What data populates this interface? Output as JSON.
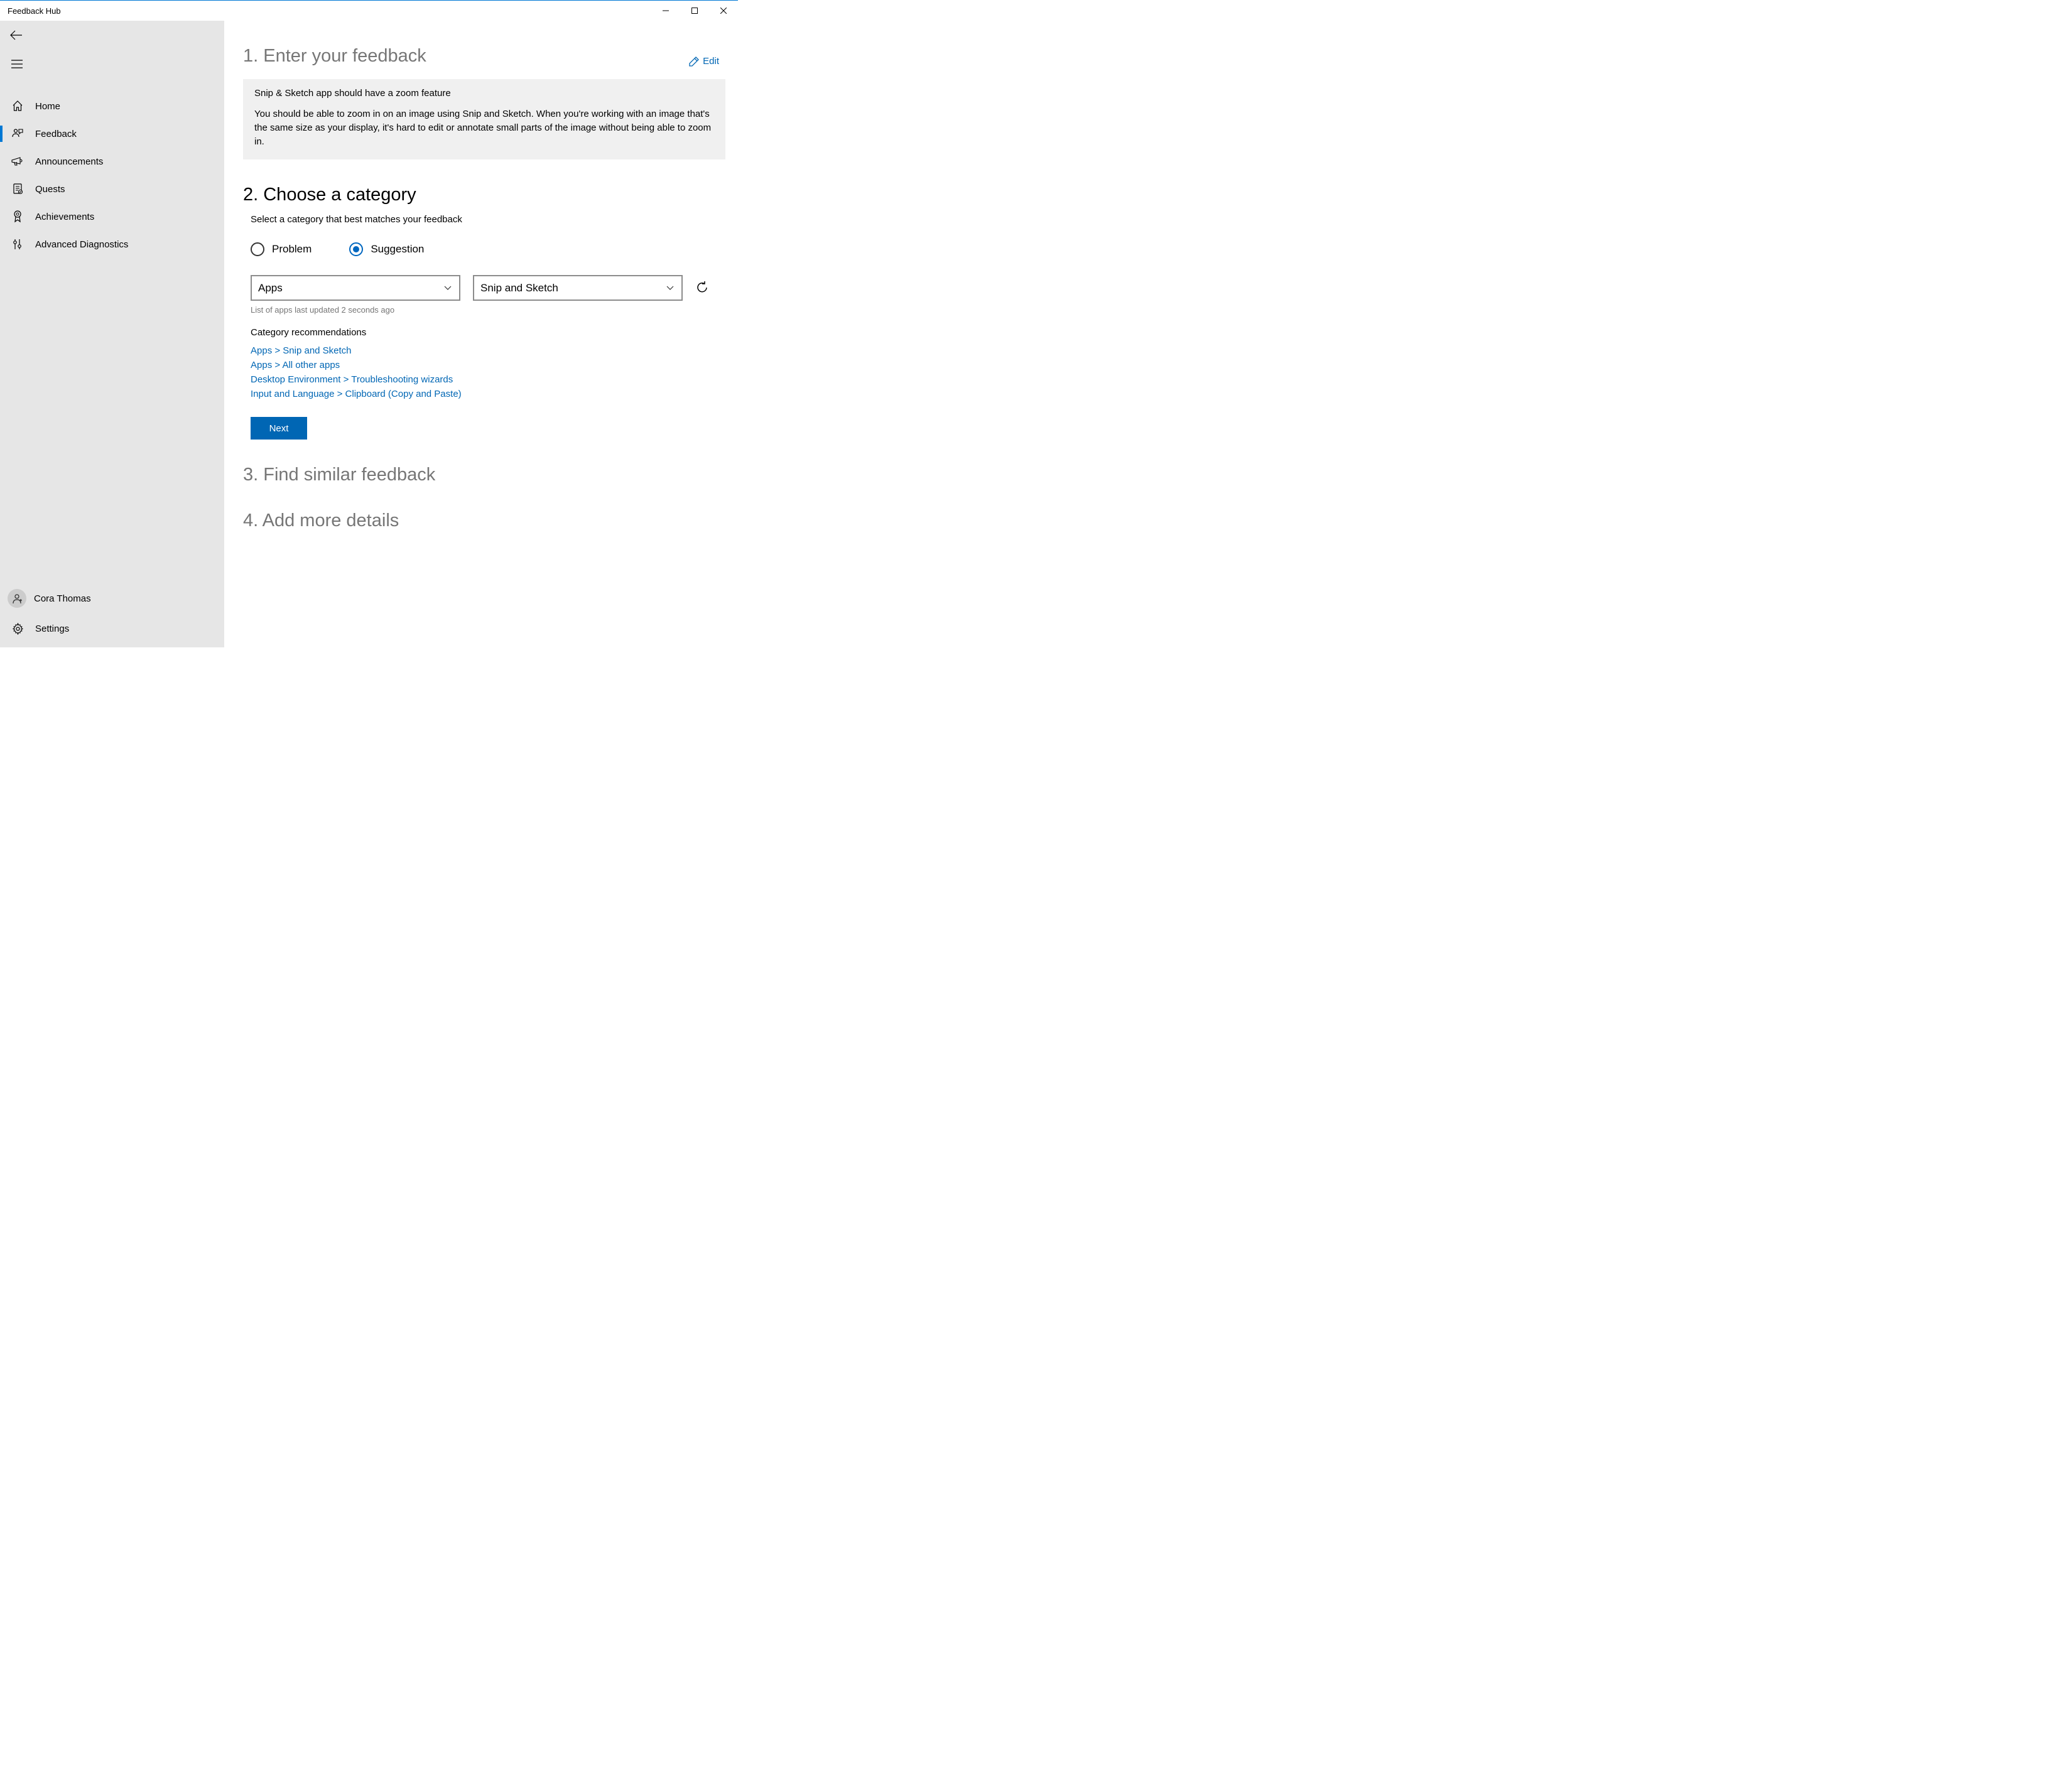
{
  "window": {
    "title": "Feedback Hub"
  },
  "sidebar": {
    "nav": [
      {
        "label": "Home"
      },
      {
        "label": "Feedback"
      },
      {
        "label": "Announcements"
      },
      {
        "label": "Quests"
      },
      {
        "label": "Achievements"
      },
      {
        "label": "Advanced Diagnostics"
      }
    ],
    "user": {
      "name": "Cora Thomas"
    },
    "settings_label": "Settings"
  },
  "step1": {
    "header": "1. Enter your feedback",
    "edit_label": "Edit",
    "title": "Snip & Sketch app should have a zoom feature",
    "description": "You should be able to zoom in on an image using Snip and Sketch. When you're working with an image that's the same size as your display, it's hard to edit or annotate small parts of the image without being able to zoom in."
  },
  "step2": {
    "header": "2. Choose a category",
    "subtitle": "Select a category that best matches your feedback",
    "radio_problem": "Problem",
    "radio_suggestion": "Suggestion",
    "category_value": "Apps",
    "subcategory_value": "Snip and Sketch",
    "list_updated": "List of apps last updated 2 seconds ago",
    "recs_title": "Category recommendations",
    "recs": [
      "Apps > Snip and Sketch",
      "Apps > All other apps",
      "Desktop Environment > Troubleshooting wizards",
      "Input and Language > Clipboard (Copy and Paste)"
    ],
    "next_label": "Next"
  },
  "step3": {
    "header": "3. Find similar feedback"
  },
  "step4": {
    "header": "4. Add more details"
  }
}
